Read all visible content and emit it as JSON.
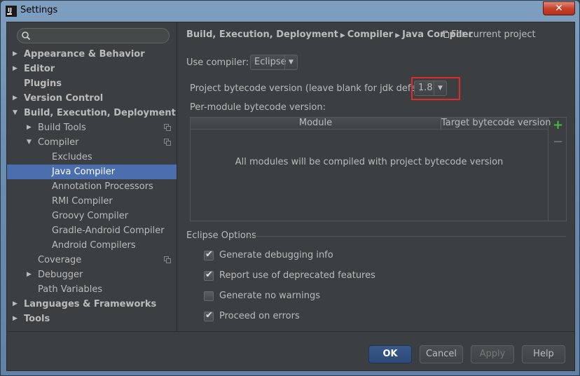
{
  "window": {
    "title": "Settings",
    "close_label": "✕"
  },
  "sidebar": {
    "search_placeholder": "",
    "items": [
      {
        "label": "Appearance & Behavior",
        "level": 0,
        "bold": true,
        "arrow": "right"
      },
      {
        "label": "Editor",
        "level": 0,
        "bold": true,
        "arrow": "right"
      },
      {
        "label": "Plugins",
        "level": 0,
        "bold": true,
        "arrow": ""
      },
      {
        "label": "Version Control",
        "level": 0,
        "bold": true,
        "arrow": "right"
      },
      {
        "label": "Build, Execution, Deployment",
        "level": 0,
        "bold": true,
        "arrow": "down"
      },
      {
        "label": "Build Tools",
        "level": 1,
        "bold": false,
        "arrow": "right",
        "copy": true
      },
      {
        "label": "Compiler",
        "level": 1,
        "bold": false,
        "arrow": "down",
        "copy": true
      },
      {
        "label": "Excludes",
        "level": 2,
        "bold": false,
        "arrow": ""
      },
      {
        "label": "Java Compiler",
        "level": 2,
        "bold": false,
        "arrow": "",
        "selected": true
      },
      {
        "label": "Annotation Processors",
        "level": 2,
        "bold": false,
        "arrow": ""
      },
      {
        "label": "RMI Compiler",
        "level": 2,
        "bold": false,
        "arrow": ""
      },
      {
        "label": "Groovy Compiler",
        "level": 2,
        "bold": false,
        "arrow": ""
      },
      {
        "label": "Gradle-Android Compiler",
        "level": 2,
        "bold": false,
        "arrow": ""
      },
      {
        "label": "Android Compilers",
        "level": 2,
        "bold": false,
        "arrow": ""
      },
      {
        "label": "Coverage",
        "level": 1,
        "bold": false,
        "arrow": "",
        "copy": true
      },
      {
        "label": "Debugger",
        "level": 1,
        "bold": false,
        "arrow": "right"
      },
      {
        "label": "Path Variables",
        "level": 1,
        "bold": false,
        "arrow": ""
      },
      {
        "label": "Languages & Frameworks",
        "level": 0,
        "bold": true,
        "arrow": "right"
      },
      {
        "label": "Tools",
        "level": 0,
        "bold": true,
        "arrow": "right"
      }
    ]
  },
  "main": {
    "breadcrumb": [
      "Build, Execution, Deployment",
      "Compiler",
      "Java Compiler"
    ],
    "scope_label": "For current project",
    "use_compiler_label": "Use compiler:",
    "use_compiler_value": "Eclipse",
    "bytecode_label": "Project bytecode version (leave blank for jdk default):",
    "bytecode_value": "1.8",
    "per_module_label": "Per-module bytecode version:",
    "table": {
      "columns": [
        "Module",
        "Target bytecode version"
      ],
      "empty_message": "All modules will be compiled with project bytecode version"
    },
    "eclipse_options_title": "Eclipse Options",
    "options": [
      {
        "label": "Generate debugging info",
        "checked": true
      },
      {
        "label": "Report use of deprecated features",
        "checked": true
      },
      {
        "label": "Generate no warnings",
        "checked": false
      },
      {
        "label": "Proceed on errors",
        "checked": true
      }
    ]
  },
  "buttons": {
    "ok": "OK",
    "cancel": "Cancel",
    "apply": "Apply",
    "help": "Help"
  },
  "colors": {
    "background": "#3c3f41",
    "selection": "#4b6eaf",
    "highlight_box": "#e02b2b",
    "add_green": "#3fbf3f"
  }
}
